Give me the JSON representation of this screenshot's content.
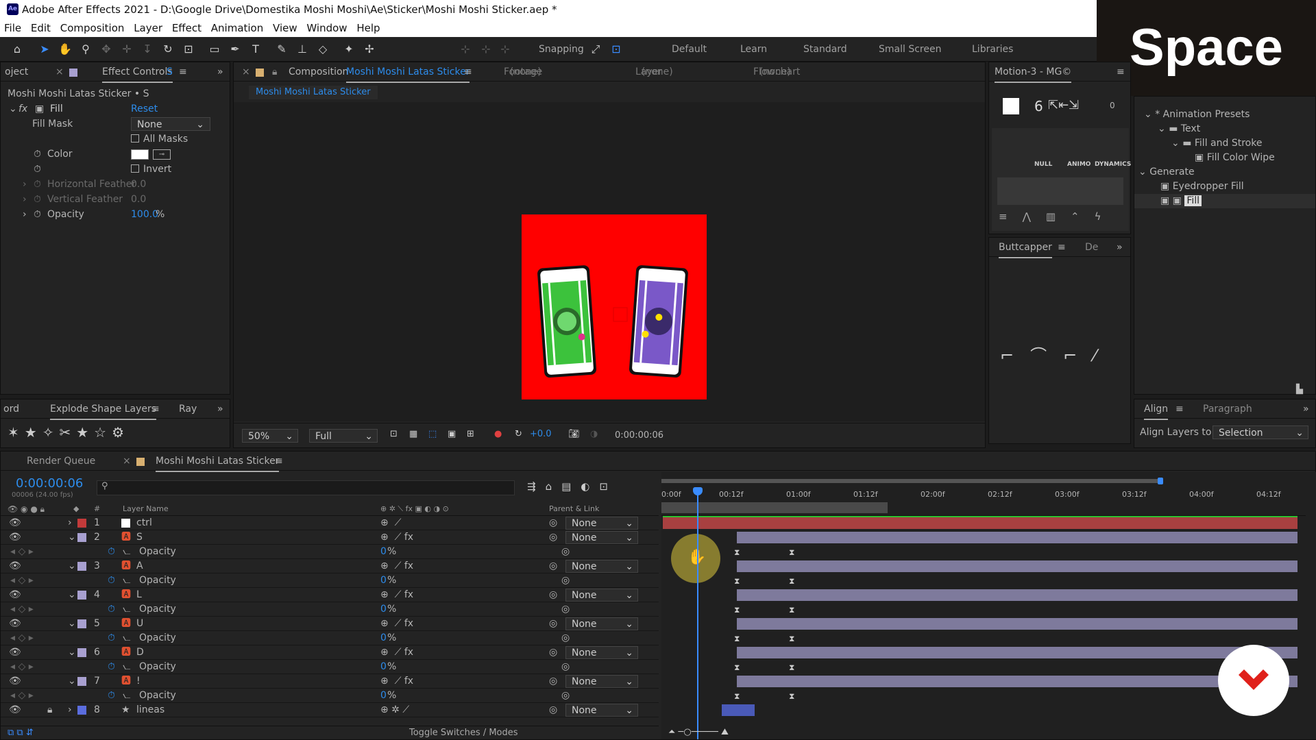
{
  "window": {
    "title": "Adobe After Effects 2021 - D:\\Google Drive\\Domestika Moshi Moshi\\Ae\\Sticker\\Moshi Moshi Sticker.aep *",
    "app_badge": "Ae"
  },
  "menu": [
    "File",
    "Edit",
    "Composition",
    "Layer",
    "Effect",
    "Animation",
    "View",
    "Window",
    "Help"
  ],
  "toolbar": {
    "snapping": "Snapping",
    "workspaces": [
      "Default",
      "Learn",
      "Standard",
      "Small Screen",
      "Libraries"
    ]
  },
  "overlay": {
    "key_label": "Space"
  },
  "effect_controls": {
    "tab_left": "oject",
    "tab": "Effect Controls",
    "tab_suffix": "S",
    "layer_path": "Moshi Moshi Latas Sticker • S",
    "effect_name": "Fill",
    "reset": "Reset",
    "fill_mask_label": "Fill Mask",
    "fill_mask_value": "None",
    "all_masks": "All Masks",
    "color_label": "Color",
    "invert": "Invert",
    "h_feather": "Horizontal Feather",
    "h_feather_val": "0.0",
    "v_feather": "Vertical Feather",
    "v_feather_val": "0.0",
    "opacity": "Opacity",
    "opacity_val": "100.0",
    "opacity_unit": "%"
  },
  "explode": {
    "tab_left": "ord",
    "tab": "Explode Shape Layers",
    "tab_right": "Ray"
  },
  "composition": {
    "tab_label": "Composition",
    "tab_name": "Moshi Moshi Latas Sticker",
    "footage": "Footage",
    "footage_val": "(none)",
    "layer": "Layer",
    "layer_val": "(none)",
    "flowchart": "Flowchart",
    "flowchart_val": "(none)",
    "breadcrumb": "Moshi Moshi Latas Sticker",
    "zoom": "50%",
    "resolution": "Full",
    "exposure": "+0.0",
    "timecode": "0:00:00:06"
  },
  "motion": {
    "tab": "Motion-3 - MG©",
    "labels": [
      "NULL",
      "ANIMO",
      "DYNAMICS"
    ],
    "six": "6",
    "zero": "0"
  },
  "buttcapper": {
    "tab": "Buttcapper",
    "tab2": "De"
  },
  "presets": {
    "items": [
      {
        "label": "* Animation Presets"
      },
      {
        "label": "Text"
      },
      {
        "label": "Fill and Stroke"
      },
      {
        "label": "Fill Color Wipe"
      },
      {
        "label": "Generate"
      },
      {
        "label": "Eyedropper Fill"
      },
      {
        "label": "Fill"
      }
    ]
  },
  "align": {
    "tab": "Align",
    "tab2": "Paragraph",
    "label": "Align Layers to:",
    "value": "Selection"
  },
  "timeline": {
    "render_queue": "Render Queue",
    "comp_tab": "Moshi Moshi Latas Sticker",
    "timecode": "0:00:00:06",
    "frames": "00006 (24.00 fps)",
    "layer_name_header": "Layer Name",
    "parent_header": "Parent & Link",
    "hash": "#",
    "ruler": [
      "0:00f",
      "00:12f",
      "01:00f",
      "01:12f",
      "02:00f",
      "02:12f",
      "03:00f",
      "03:12f",
      "04:00f",
      "04:12f"
    ],
    "toggle": "Toggle Switches / Modes",
    "layers": [
      {
        "num": "1",
        "name": "ctrl",
        "parent": "None",
        "color": "#c23a3a",
        "prop": ""
      },
      {
        "num": "2",
        "name": "S",
        "parent": "None",
        "color": "#a8a0d0",
        "prop": "Opacity",
        "val": "0"
      },
      {
        "num": "3",
        "name": "A",
        "parent": "None",
        "color": "#a8a0d0",
        "prop": "Opacity",
        "val": "0"
      },
      {
        "num": "4",
        "name": "L",
        "parent": "None",
        "color": "#a8a0d0",
        "prop": "Opacity",
        "val": "0"
      },
      {
        "num": "5",
        "name": "U",
        "parent": "None",
        "color": "#a8a0d0",
        "prop": "Opacity",
        "val": "0"
      },
      {
        "num": "6",
        "name": "D",
        "parent": "None",
        "color": "#a8a0d0",
        "prop": "Opacity",
        "val": "0"
      },
      {
        "num": "7",
        "name": "!",
        "parent": "None",
        "color": "#a8a0d0",
        "prop": "Opacity",
        "val": "0"
      },
      {
        "num": "8",
        "name": "lineas",
        "parent": "None",
        "color": "#5b6dde",
        "prop": ""
      }
    ],
    "pct": "%"
  }
}
